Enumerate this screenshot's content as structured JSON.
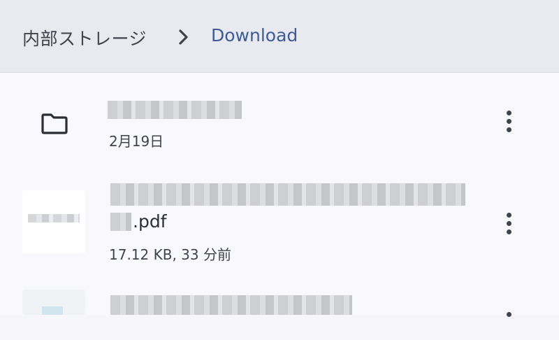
{
  "breadcrumb": {
    "root_label": "内部ストレージ",
    "current_label": "Download"
  },
  "files": [
    {
      "type": "folder",
      "icon": "folder-icon",
      "meta": "2月19日"
    },
    {
      "type": "pdf",
      "icon": "pdf-thumbnail",
      "name_suffix": ".pdf",
      "meta": "17.12 KB, 33 分前"
    },
    {
      "type": "image",
      "icon": "image-thumbnail"
    }
  ],
  "colors": {
    "header_bg": "#e8eaf0",
    "list_bg": "#f9f9fd",
    "accent": "#3e5c96",
    "text": "#3f434b"
  }
}
